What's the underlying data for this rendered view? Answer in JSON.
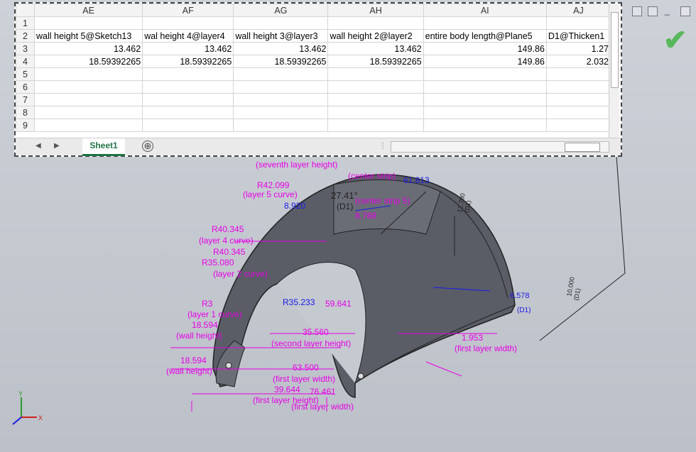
{
  "spreadsheet": {
    "columns": [
      "AE",
      "AF",
      "AG",
      "AH",
      "AI",
      "AJ"
    ],
    "row_numbers": [
      "1",
      "2",
      "3",
      "4",
      "5",
      "6",
      "7",
      "8",
      "9"
    ],
    "rows": [
      [
        "",
        "",
        "",
        "",
        "",
        ""
      ],
      [
        "wall height 5@Sketch13",
        "wal height 4@layer4",
        "wall height 3@layer3",
        "wall height 2@layer2",
        "entire body length@Plane5",
        "D1@Thicken1"
      ],
      [
        "13.462",
        "13.462",
        "13.462",
        "13.462",
        "149.86",
        "1.27"
      ],
      [
        "18.59392265",
        "18.59392265",
        "18.59392265",
        "18.59392265",
        "149.86",
        "2.032"
      ],
      [
        "",
        "",
        "",
        "",
        "",
        ""
      ],
      [
        "",
        "",
        "",
        "",
        "",
        ""
      ],
      [
        "",
        "",
        "",
        "",
        "",
        ""
      ],
      [
        "",
        "",
        "",
        "",
        "",
        ""
      ],
      [
        "",
        "",
        "",
        "",
        "",
        ""
      ]
    ],
    "sheet_tab": "Sheet1",
    "add_sheet_symbol": "⊕"
  },
  "icons": {
    "confirm": "check-icon",
    "triad": "xyz-triad-icon"
  },
  "colors": {
    "dimension": "#e800e8",
    "annotation": "#1a1ae6",
    "excel_green": "#217346",
    "confirm_green": "#58b85a",
    "part_fill": "#5a5d66"
  },
  "annotations": {
    "top_labels": [
      "(seventh layer height)",
      "(center strip)",
      "(center strip 5)",
      "27.41°",
      "(D1)",
      "61.813",
      "8.920",
      "8.788"
    ],
    "left_labels": [
      "R42.099",
      "(layer 5 curve)",
      "R40.345",
      "(layer 4 curve)",
      "R40.345",
      "R35.080",
      "(layer 2 curve)",
      "R3",
      "(layer 1 curve)",
      "18.594",
      "(wall height)",
      "18.594",
      "(wall height)"
    ],
    "bottom_labels": [
      "63.500",
      "(first layer width)",
      "39.644",
      "76.461",
      "(first layer height)",
      "(first layer width)",
      "(second layer height)",
      "35.560",
      "59.641",
      "R35.233",
      "(first layer width)",
      "1.953"
    ],
    "right_labels": [
      "12.700",
      "(D1)",
      "10.000",
      "(D1)",
      "6.578",
      "(D1)"
    ],
    "triad_axes": [
      "Y",
      "X"
    ]
  }
}
